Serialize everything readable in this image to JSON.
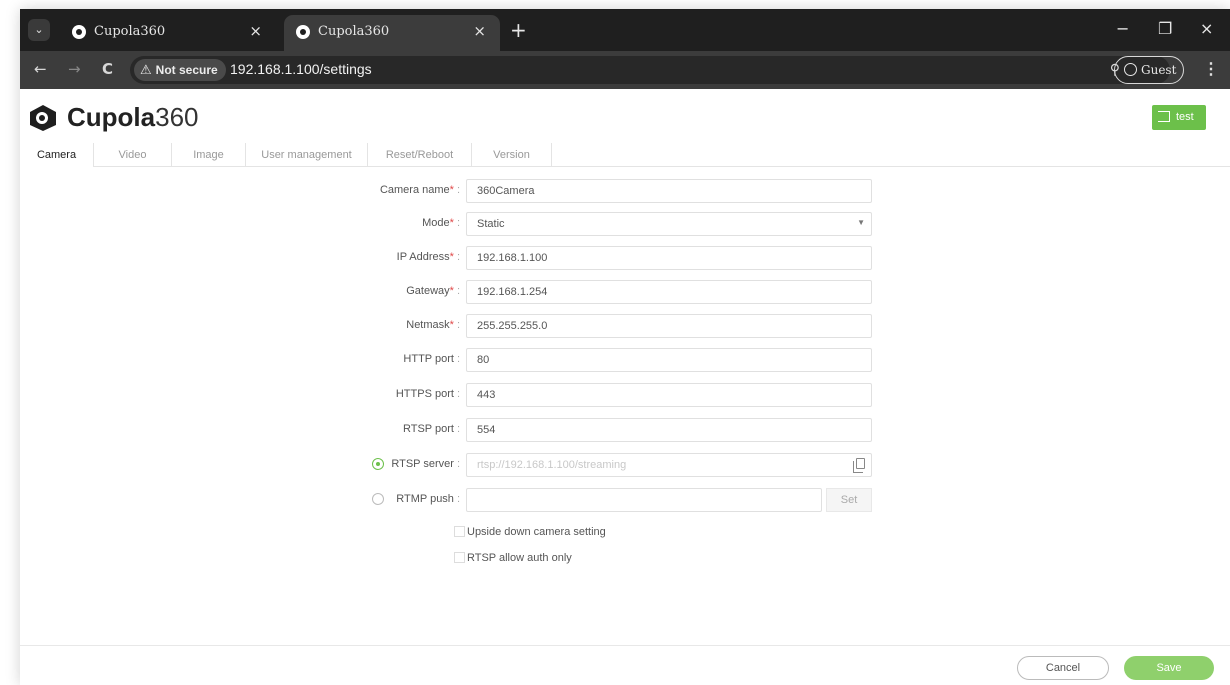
{
  "browser": {
    "tabs": [
      {
        "title": "Cupola360",
        "close": "×"
      },
      {
        "title": "Cupola360",
        "close": "×"
      }
    ],
    "new_tab": "+",
    "window_controls": {
      "minimize": "−",
      "restore": "❐",
      "close": "×"
    },
    "nav": {
      "back": "←",
      "forward": "→",
      "reload": "C"
    },
    "security_chip": {
      "icon": "⚠",
      "label": "Not secure"
    },
    "url": "192.168.1.100/settings",
    "profile_label": "Guest",
    "menu": "⋮",
    "zoom_icon": "⚲"
  },
  "app": {
    "brand_bold": "Cupola",
    "brand_light": "360",
    "logout_label": "test",
    "tabs": [
      "Camera",
      "Video",
      "Image",
      "User management",
      "Reset/Reboot",
      "Version"
    ],
    "active_tab": "Camera",
    "form": {
      "camera_name": {
        "label": "Camera name",
        "value": "360Camera"
      },
      "mode": {
        "label": "Mode",
        "value": "Static"
      },
      "ip_address": {
        "label": "IP Address",
        "value": "192.168.1.100"
      },
      "gateway": {
        "label": "Gateway",
        "value": "192.168.1.254"
      },
      "netmask": {
        "label": "Netmask",
        "value": "255.255.255.0"
      },
      "http_port": {
        "label": "HTTP port",
        "value": "80"
      },
      "https_port": {
        "label": "HTTPS port",
        "value": "443"
      },
      "rtsp_port": {
        "label": "RTSP port",
        "value": "554"
      },
      "rtsp_server": {
        "label": "RTSP server",
        "value": "rtsp://192.168.1.100/streaming",
        "selected": true
      },
      "rtmp_push": {
        "label": "RTMP push",
        "value": "",
        "selected": false,
        "button": "Set"
      },
      "upside_down": {
        "label": "Upside down camera setting",
        "checked": false
      },
      "rtsp_auth": {
        "label": "RTSP allow auth only",
        "checked": false
      }
    },
    "required_mark": "*",
    "colon": ":",
    "footer": {
      "cancel": "Cancel",
      "save": "Save"
    },
    "accent_color": "#6cc04a"
  }
}
